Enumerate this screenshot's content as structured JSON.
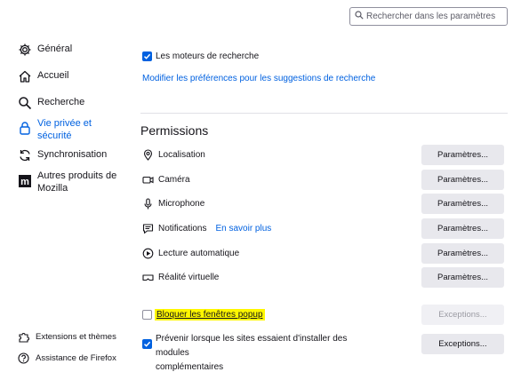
{
  "search": {
    "placeholder": "Rechercher dans les paramètres"
  },
  "sidebar": {
    "items": [
      {
        "label": "Général",
        "icon": "gear-icon"
      },
      {
        "label": "Accueil",
        "icon": "home-icon"
      },
      {
        "label": "Recherche",
        "icon": "search-icon"
      },
      {
        "label": "Vie privée et sécurité",
        "icon": "lock-icon",
        "active": true
      },
      {
        "label": "Synchronisation",
        "icon": "sync-icon"
      },
      {
        "label": "Autres produits de Mozilla",
        "icon": "mozilla-icon"
      }
    ],
    "footer": [
      {
        "label": "Extensions et thèmes",
        "icon": "puzzle-icon"
      },
      {
        "label": "Assistance de Firefox",
        "icon": "help-icon"
      }
    ]
  },
  "search_engines": {
    "checkbox_label": "Les moteurs de recherche",
    "checked": true,
    "link": "Modifier les préférences pour les suggestions de recherche"
  },
  "permissions": {
    "title": "Permissions",
    "items": [
      {
        "label": "Localisation",
        "icon": "location-icon",
        "button": "Paramètres..."
      },
      {
        "label": "Caméra",
        "icon": "camera-icon",
        "button": "Paramètres..."
      },
      {
        "label": "Microphone",
        "icon": "microphone-icon",
        "button": "Paramètres..."
      },
      {
        "label": "Notifications",
        "icon": "notification-icon",
        "button": "Paramètres...",
        "link": "En savoir plus"
      },
      {
        "label": "Lecture automatique",
        "icon": "autoplay-icon",
        "button": "Paramètres..."
      },
      {
        "label": "Réalité virtuelle",
        "icon": "vr-icon",
        "button": "Paramètres..."
      }
    ],
    "popup": {
      "label": "Bloquer les fenêtres popup",
      "checked": false,
      "button": "Exceptions..."
    },
    "addons": {
      "label_line1": "Prévenir lorsque les sites essaient d'installer des modules",
      "label_line2": "complémentaires",
      "checked": true,
      "button": "Exceptions..."
    }
  },
  "colors": {
    "accent": "#0061e0",
    "highlight": "#fff700"
  }
}
